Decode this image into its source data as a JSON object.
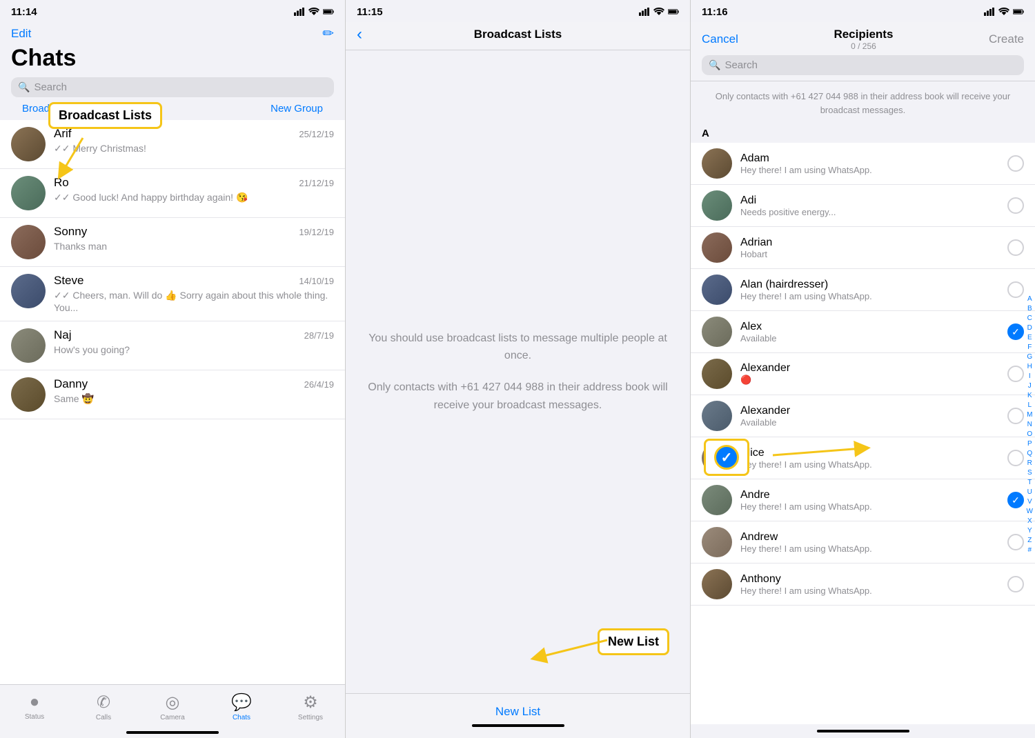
{
  "panel1": {
    "status_time": "11:14",
    "edit_label": "Edit",
    "title": "Chats",
    "search_placeholder": "Search",
    "broadcast_lists_label": "Broadcast Lists",
    "new_group_label": "New Group",
    "chats": [
      {
        "name": "Arif",
        "time": "25/12/19",
        "preview": "✓✓ Merry Christmas!",
        "avatar_class": "ca-1"
      },
      {
        "name": "Ro",
        "time": "21/12/19",
        "preview": "✓✓ Good luck! And happy birthday again! 😘",
        "avatar_class": "ca-2"
      },
      {
        "name": "Sonny",
        "time": "19/12/19",
        "preview": "Thanks man",
        "avatar_class": "ca-3"
      },
      {
        "name": "Steve",
        "time": "14/10/19",
        "preview": "✓✓ Cheers, man. Will do 👍 Sorry again about this whole thing. You...",
        "avatar_class": "ca-4"
      },
      {
        "name": "Naj",
        "time": "28/7/19",
        "preview": "How's you going?",
        "avatar_class": "ca-5"
      },
      {
        "name": "Danny",
        "time": "26/4/19",
        "preview": "Same 🤠",
        "avatar_class": "ca-6"
      }
    ],
    "tabs": [
      {
        "label": "Status",
        "icon": "○"
      },
      {
        "label": "Calls",
        "icon": "☎"
      },
      {
        "label": "Camera",
        "icon": "⊙"
      },
      {
        "label": "Chats",
        "icon": "💬",
        "active": true
      },
      {
        "label": "Settings",
        "icon": "⚙"
      }
    ],
    "annotation": "Broadcast Lists"
  },
  "panel2": {
    "status_time": "11:15",
    "title": "Broadcast Lists",
    "body_text_1": "You should use broadcast lists to message multiple people at once.",
    "body_text_2": "Only contacts with +61 427 044 988 in their address book will receive your broadcast messages.",
    "new_list_label": "New List",
    "annotation": "New List"
  },
  "panel3": {
    "status_time": "11:16",
    "cancel_label": "Cancel",
    "title": "Recipients",
    "count": "0 / 256",
    "create_label": "Create",
    "search_placeholder": "Search",
    "info_text": "Only contacts with +61 427 044 988 in their address book will receive your broadcast messages.",
    "section_a": "A",
    "contacts": [
      {
        "name": "Adam",
        "status": "Hey there! I am using WhatsApp.",
        "selected": false,
        "avatar_class": "ca-1"
      },
      {
        "name": "Adi",
        "status": "Needs positive energy...",
        "selected": false,
        "avatar_class": "ca-2"
      },
      {
        "name": "Adrian",
        "status": "Hobart",
        "selected": false,
        "avatar_class": "ca-3"
      },
      {
        "name": "Alan (hairdresser)",
        "status": "Hey there! I am using WhatsApp.",
        "selected": false,
        "avatar_class": "ca-4"
      },
      {
        "name": "Alex",
        "status": "Available",
        "selected": true,
        "avatar_class": "ca-5"
      },
      {
        "name": "Alexander",
        "status": "🔴",
        "selected": false,
        "avatar_class": "ca-6"
      },
      {
        "name": "Alexander",
        "status": "Available",
        "selected": false,
        "avatar_class": "ca-7"
      },
      {
        "name": "Alice",
        "status": "Hey there! I am using WhatsApp.",
        "selected": false,
        "avatar_class": "ca-8"
      },
      {
        "name": "Andre",
        "status": "Hey there! I am using WhatsApp.",
        "selected": true,
        "avatar_class": "ca-9"
      },
      {
        "name": "Andrew",
        "status": "Hey there! I am using WhatsApp.",
        "selected": false,
        "avatar_class": "ca-10"
      },
      {
        "name": "Anthony",
        "status": "Hey there! I am using WhatsApp.",
        "selected": false,
        "avatar_class": "ca-1"
      }
    ],
    "alpha_letters": [
      "A",
      "B",
      "C",
      "D",
      "E",
      "F",
      "G",
      "H",
      "I",
      "J",
      "K",
      "L",
      "M",
      "N",
      "O",
      "P",
      "Q",
      "R",
      "S",
      "T",
      "U",
      "V",
      "W",
      "X",
      "Y",
      "Z",
      "#"
    ]
  }
}
